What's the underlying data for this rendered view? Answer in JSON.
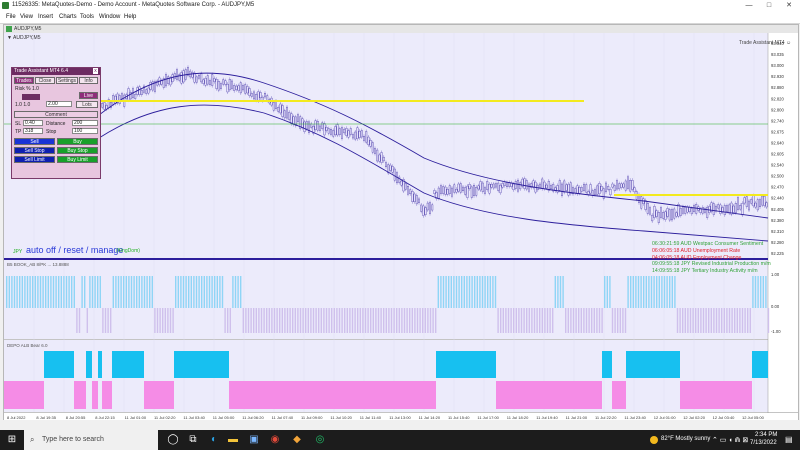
{
  "window": {
    "title": "11526335: MetaQuotes-Demo - Demo Account - MetaQuotes Software Corp. - AUDJPY,M5",
    "minimize": "—",
    "maximize": "□",
    "close": "✕"
  },
  "menu": [
    "File",
    "View",
    "Insert",
    "Charts",
    "Tools",
    "Window",
    "Help"
  ],
  "chart": {
    "window_title": "AUDJPY,M5",
    "symbol_label": "▼ AUDJPY,M5",
    "ea_label": "Trade Assistant MT4 ☺",
    "watermark": "auto off / reset / manage",
    "watermark_small": "JPY",
    "watermark_suffix": "(KingDom)",
    "indicator1_label": "B5 BOOK_AB 8/PK ... 13.8888",
    "indicator2_label": "DEPO ALB Bear 6.0",
    "price_labels": [
      "93.040",
      "93.035",
      "93.000",
      "92.930",
      "92.880",
      "92.820",
      "92.800",
      "92.740",
      "92.675",
      "92.640",
      "92.605",
      "92.540",
      "92.500",
      "92.470",
      "92.440",
      "92.405",
      "92.380",
      "92.310",
      "92.280",
      "92.225"
    ],
    "ind1_levels": [
      "1.00",
      "0.00",
      "-1.00"
    ],
    "time_labels": [
      "8 Jul 2022",
      "8 Jul 19:35",
      "8 Jul 20:55",
      "8 Jul 22:15",
      "11 Jul 01:00",
      "11 Jul 02:20",
      "11 Jul 03:40",
      "11 Jul 05:00",
      "11 Jul 06:20",
      "11 Jul 07:40",
      "11 Jul 09:00",
      "11 Jul 10:20",
      "11 Jul 11:40",
      "11 Jul 13:00",
      "11 Jul 14:20",
      "11 Jul 15:40",
      "11 Jul 17:00",
      "11 Jul 18:20",
      "11 Jul 19:40",
      "11 Jul 21:00",
      "11 Jul 22:20",
      "11 Jul 23:40",
      "12 Jul 01:00",
      "12 Jul 02:20",
      "12 Jul 03:40",
      "12 Jul 05:00"
    ],
    "colors": {
      "price": "#3a2aa0",
      "band": "#2c1e9c",
      "yellow": "#f3ea1e",
      "green": "#22b022",
      "cyan": "#17c0f0",
      "pink": "#f58ce6",
      "grid": "#e4e4e4"
    }
  },
  "news": [
    {
      "text": "06:30:21:59  AUD  Westpac Consumer Sentiment",
      "color": "#33a33a"
    },
    {
      "text": "06:06:05:18  AUD  Unemployment Rate",
      "color": "#e0202a"
    },
    {
      "text": "04:06:05:18  AUD  Employment Change",
      "color": "#e0202a"
    },
    {
      "text": "09:09:55:18  JPY  Revised Industrial Production m/m",
      "color": "#33a33a"
    },
    {
      "text": "14:09:55:18  JPY  Tertiary Industry Activity m/m",
      "color": "#33a33a"
    }
  ],
  "panel": {
    "title": "Trade Assistant MT4 6.4",
    "tabs": [
      "Trades",
      "Close",
      "Settings",
      "Info"
    ],
    "risk_label": "Risk % 1.0",
    "pairs_label": "1.0  1.0",
    "lots_label": "Lots",
    "lots_value": "2.00",
    "comment_label": "Comment",
    "sl_label": "SL",
    "sl_value": "0.40",
    "distance_label": "Distance",
    "distance_value": "200",
    "tp_label": "TP",
    "tp_value": "318",
    "stop_label": "Stop",
    "stop_value": "100",
    "sell_label": "Sell",
    "buy_label": "Buy",
    "sell_stop_label": "Sell Stop",
    "buy_stop_label": "Buy Stop",
    "sell_limit_label": "Sell Limit",
    "buy_limit_label": "Buy Limit",
    "live_label": "Live"
  },
  "taskbar": {
    "search_placeholder": "Type here to search",
    "weather": "82°F  Mostly sunny",
    "time": "2:34 PM",
    "date": "7/13/2022"
  }
}
